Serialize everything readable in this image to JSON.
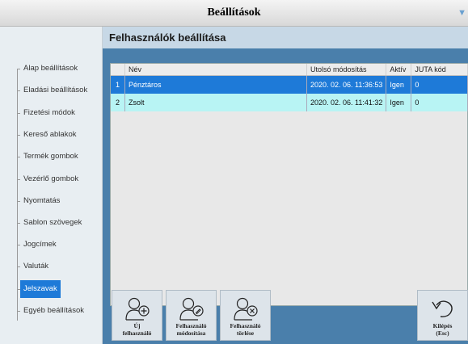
{
  "window": {
    "title": "Beállítások"
  },
  "sidebar": {
    "items": [
      {
        "label": "Alap beállítások",
        "active": false
      },
      {
        "label": "Eladási beállítások",
        "active": false
      },
      {
        "label": "Fizetési módok",
        "active": false
      },
      {
        "label": "Kereső ablakok",
        "active": false
      },
      {
        "label": "Termék gombok",
        "active": false
      },
      {
        "label": "Vezérlő gombok",
        "active": false
      },
      {
        "label": "Nyomtatás",
        "active": false
      },
      {
        "label": "Sablon szövegek",
        "active": false
      },
      {
        "label": "Jogcímek",
        "active": false
      },
      {
        "label": "Valuták",
        "active": false
      },
      {
        "label": "Jelszavak",
        "active": true
      },
      {
        "label": "Egyéb beállítások",
        "active": false
      }
    ]
  },
  "main": {
    "title": "Felhasználók beállítása",
    "table": {
      "columns": [
        "",
        "Név",
        "Utolsó módosítás",
        "Aktív",
        "JUTA kód"
      ],
      "rows": [
        [
          "1",
          "Pénztáros",
          "2020. 02. 06. 11:36:53",
          "Igen",
          "0"
        ],
        [
          "2",
          "Zsolt",
          "2020. 02. 06. 11:41:32",
          "Igen",
          "0"
        ]
      ]
    }
  },
  "toolbar": {
    "new_user": "Új\nfelhasználó",
    "edit_user": "Felhasználó\nmódosítása",
    "delete_user": "Felhasználó\ntörlése",
    "exit": "Kilépés\n(Esc)"
  },
  "colors": {
    "accent": "#1e7ad8",
    "selected_row": "#1e7ad8",
    "alt_row": "#b8f4f4",
    "panel": "#4a7fab"
  }
}
